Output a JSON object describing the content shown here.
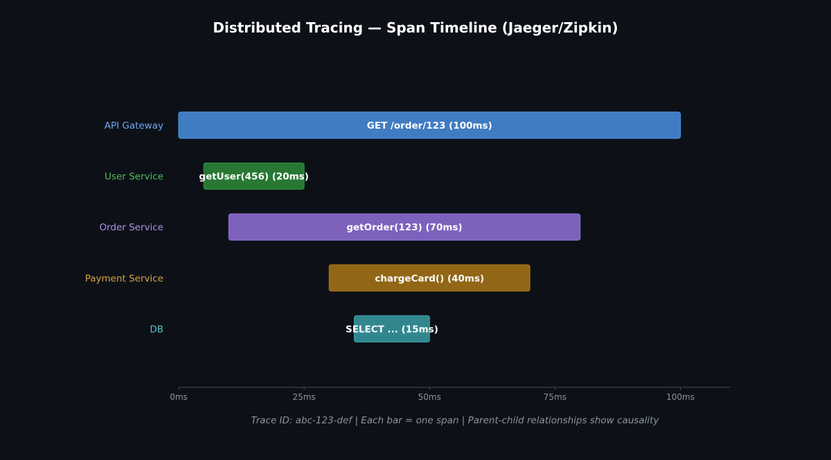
{
  "chart_data": {
    "type": "gantt",
    "title": "Distributed Tracing — Span Timeline (Jaeger/Zipkin)",
    "xlabel": "",
    "ylabel": "",
    "xlim": [
      0,
      110
    ],
    "x_unit": "ms",
    "x_ticks": [
      {
        "value": 0,
        "label": "0ms"
      },
      {
        "value": 25,
        "label": "25ms"
      },
      {
        "value": 50,
        "label": "50ms"
      },
      {
        "value": 75,
        "label": "75ms"
      },
      {
        "value": 100,
        "label": "100ms"
      }
    ],
    "grid": false,
    "spans": [
      {
        "service": "API Gateway",
        "label": "GET /order/123 (100ms)",
        "start": 0,
        "duration": 100,
        "color": "#4a8fe0",
        "label_color": "#6ea8f0"
      },
      {
        "service": "User Service",
        "label": "getUser(456) (20ms)",
        "start": 5,
        "duration": 20,
        "color": "#2e8b3a",
        "label_color": "#4fbf5b"
      },
      {
        "service": "Order Service",
        "label": "getOrder(123) (70ms)",
        "start": 10,
        "duration": 70,
        "color": "#9370db",
        "label_color": "#b08fe8"
      },
      {
        "service": "Payment Service",
        "label": "chargeCard() (40ms)",
        "start": 30,
        "duration": 40,
        "color": "#a97616",
        "label_color": "#d9a440"
      },
      {
        "service": "DB",
        "label": "SELECT ... (15ms)",
        "start": 35,
        "duration": 15,
        "color": "#3a9ca5",
        "label_color": "#5fc0c8"
      }
    ],
    "footnote": "Trace ID: abc-123-def  |  Each bar = one span  |  Parent-child relationships show causality",
    "colors": {
      "background": "#0d1117",
      "axis": "#444c56",
      "tick_text": "#8b949e",
      "title": "#ffffff"
    }
  }
}
